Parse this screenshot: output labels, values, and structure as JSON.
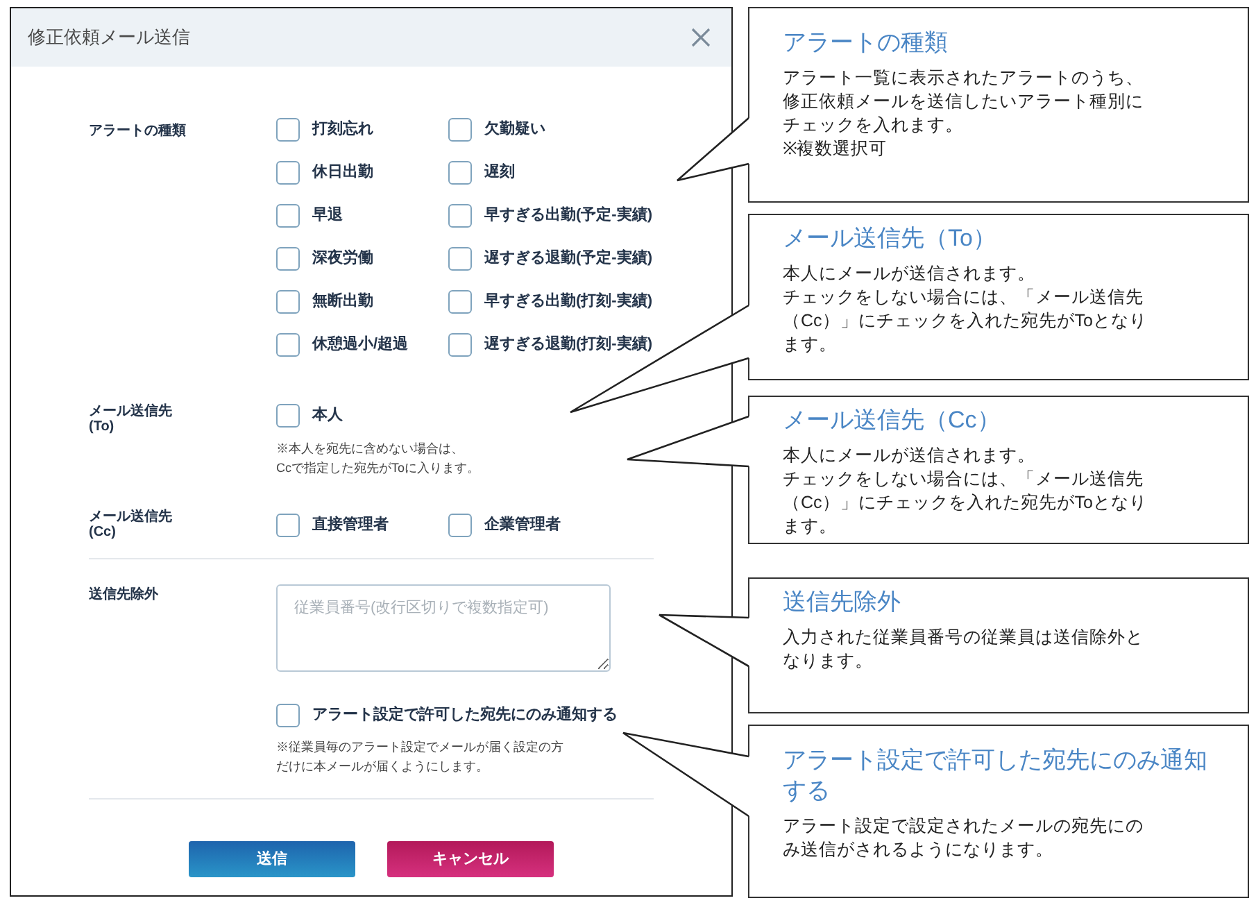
{
  "dialog": {
    "title": "修正依頼メール送信",
    "alert_types": {
      "label": "アラートの種類",
      "options": [
        {
          "label": "打刻忘れ",
          "checked": false
        },
        {
          "label": "欠勤疑い",
          "checked": false
        },
        {
          "label": "休日出勤",
          "checked": false
        },
        {
          "label": "遅刻",
          "checked": false
        },
        {
          "label": "早退",
          "checked": false
        },
        {
          "label": "早すぎる出勤(予定-実績)",
          "checked": false
        },
        {
          "label": "深夜労働",
          "checked": false
        },
        {
          "label": "遅すぎる退勤(予定-実績)",
          "checked": false
        },
        {
          "label": "無断出勤",
          "checked": false
        },
        {
          "label": "早すぎる出勤(打刻-実績)",
          "checked": false
        },
        {
          "label": "休憩過小/超過",
          "checked": false
        },
        {
          "label": "遅すぎる退勤(打刻-実績)",
          "checked": false
        }
      ]
    },
    "mail_to": {
      "label_lines": [
        "メール送信先",
        "(To)"
      ],
      "options": [
        {
          "label": "本人",
          "checked": false
        }
      ],
      "note_lines": [
        "※本人を宛先に含めない場合は、",
        "Ccで指定した宛先がToに入ります。"
      ]
    },
    "mail_cc": {
      "label_lines": [
        "メール送信先",
        "(Cc)"
      ],
      "options": [
        {
          "label": "直接管理者",
          "checked": false
        },
        {
          "label": "企業管理者",
          "checked": false
        }
      ]
    },
    "exclude": {
      "label": "送信先除外",
      "placeholder": "従業員番号(改行区切りで複数指定可)"
    },
    "permitted_only": {
      "label": "アラート設定で許可した宛先にのみ通知する",
      "checked": false,
      "note_lines": [
        "※従業員毎のアラート設定でメールが届く設定の方",
        "だけに本メールが届くようにします。"
      ]
    },
    "buttons": [
      {
        "label": "送信",
        "kind": "primary"
      },
      {
        "label": "キャンセル",
        "kind": "danger"
      }
    ]
  },
  "callouts": [
    {
      "title": "アラートの種類",
      "body_lines": [
        "アラート一覧に表示されたアラートのうち、",
        "修正依頼メールを送信したいアラート種別に",
        "チェックを入れます。",
        "※複数選択可"
      ]
    },
    {
      "title": "メール送信先（To）",
      "body_lines": [
        "本人にメールが送信されます。",
        "チェックをしない場合には、「メール送信先",
        "（Cc）」にチェックを入れた宛先がToとなり",
        "ます。"
      ]
    },
    {
      "title": "メール送信先（Cc）",
      "body_lines": [
        "本人にメールが送信されます。",
        "チェックをしない場合には、「メール送信先",
        "（Cc）」にチェックを入れた宛先がToとなり",
        "ます。"
      ]
    },
    {
      "title": "送信先除外",
      "body_lines": [
        "入力された従業員番号の従業員は送信除外と",
        "なります。"
      ]
    },
    {
      "title": "アラート設定で許可した宛先にのみ通知する",
      "body_lines": [
        "アラート設定で設定されたメールの宛先にの",
        "み送信がされるようになります。"
      ]
    }
  ]
}
